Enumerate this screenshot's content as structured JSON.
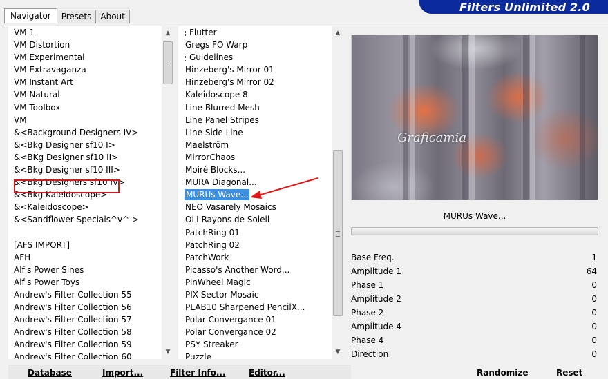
{
  "tabs": [
    "Navigator",
    "Presets",
    "About"
  ],
  "app_title": "Filters Unlimited 2.0",
  "categories": [
    "VM 1",
    "VM Distortion",
    "VM Experimental",
    "VM Extravaganza",
    "VM Instant Art",
    "VM Natural",
    "VM Toolbox",
    "VM",
    "&<Background Designers IV>",
    "&<Bkg Designer sf10 I>",
    "&<BKg Designer sf10 II>",
    "&<Bkg Designer sf10 III>",
    "&<Bkg Designers sf10 IV>",
    "&<Bkg Kaleidoscope>",
    "&<Kaleidoscope>",
    "&<Sandflower Specials^v^ >",
    "",
    "[AFS IMPORT]",
    "AFH",
    "Alf's Power Sines",
    "Alf's Power Toys",
    "Andrew's Filter Collection 55",
    "Andrew's Filter Collection 56",
    "Andrew's Filter Collection 57",
    "Andrew's Filter Collection 58",
    "Andrew's Filter Collection 59",
    "Andrew's Filter Collection 60"
  ],
  "filters": [
    "Flutter",
    "Gregs FO Warp",
    "Guidelines",
    "Hinzeberg's Mirror 01",
    "Hinzeberg's Mirror 02",
    "Kaleidoscope 8",
    "Line Blurred Mesh",
    "Line Panel Stripes",
    "Line Side Line",
    "Maelström",
    "MirrorChaos",
    "Moiré Blocks...",
    "MURA Diagonal...",
    "MURUs Wave...",
    "NEO Vasarely Mosaics",
    "OLI Rayons de Soleil",
    "PatchRing 01",
    "PatchRing 02",
    "PatchWork",
    "Picasso's Another Word...",
    "PinWheel Magic",
    "PIX Sector Mosaic",
    "PLAB10 Sharpened PencilX...",
    "Polar Convergance 01",
    "Polar Convergance 02",
    "PSY Streaker",
    "Puzzle"
  ],
  "filters_with_grip": [
    "Flutter",
    "Guidelines"
  ],
  "selected_category": "&<BKg Designer sf10 II>",
  "selected_filter": "MURUs Wave...",
  "preview_watermark": "Graficamia",
  "params": [
    {
      "label": "Base Freq.",
      "value": "1"
    },
    {
      "label": "Amplitude 1",
      "value": "64"
    },
    {
      "label": "Phase 1",
      "value": "0"
    },
    {
      "label": "Amplitude 2",
      "value": "0"
    },
    {
      "label": "Phase 2",
      "value": "0"
    },
    {
      "label": "Amplitude 4",
      "value": "0"
    },
    {
      "label": "Phase 4",
      "value": "0"
    },
    {
      "label": "Direction",
      "value": "0"
    }
  ],
  "buttons": {
    "database": "Database",
    "import": "Import...",
    "filter_info": "Filter Info...",
    "editor": "Editor...",
    "randomize": "Randomize",
    "reset": "Reset"
  },
  "colors": {
    "banner": "#0b2a9c",
    "selection": "#3d8fe0",
    "highlight_box": "#cf1b1b",
    "annotation_arrow": "#e01818"
  }
}
